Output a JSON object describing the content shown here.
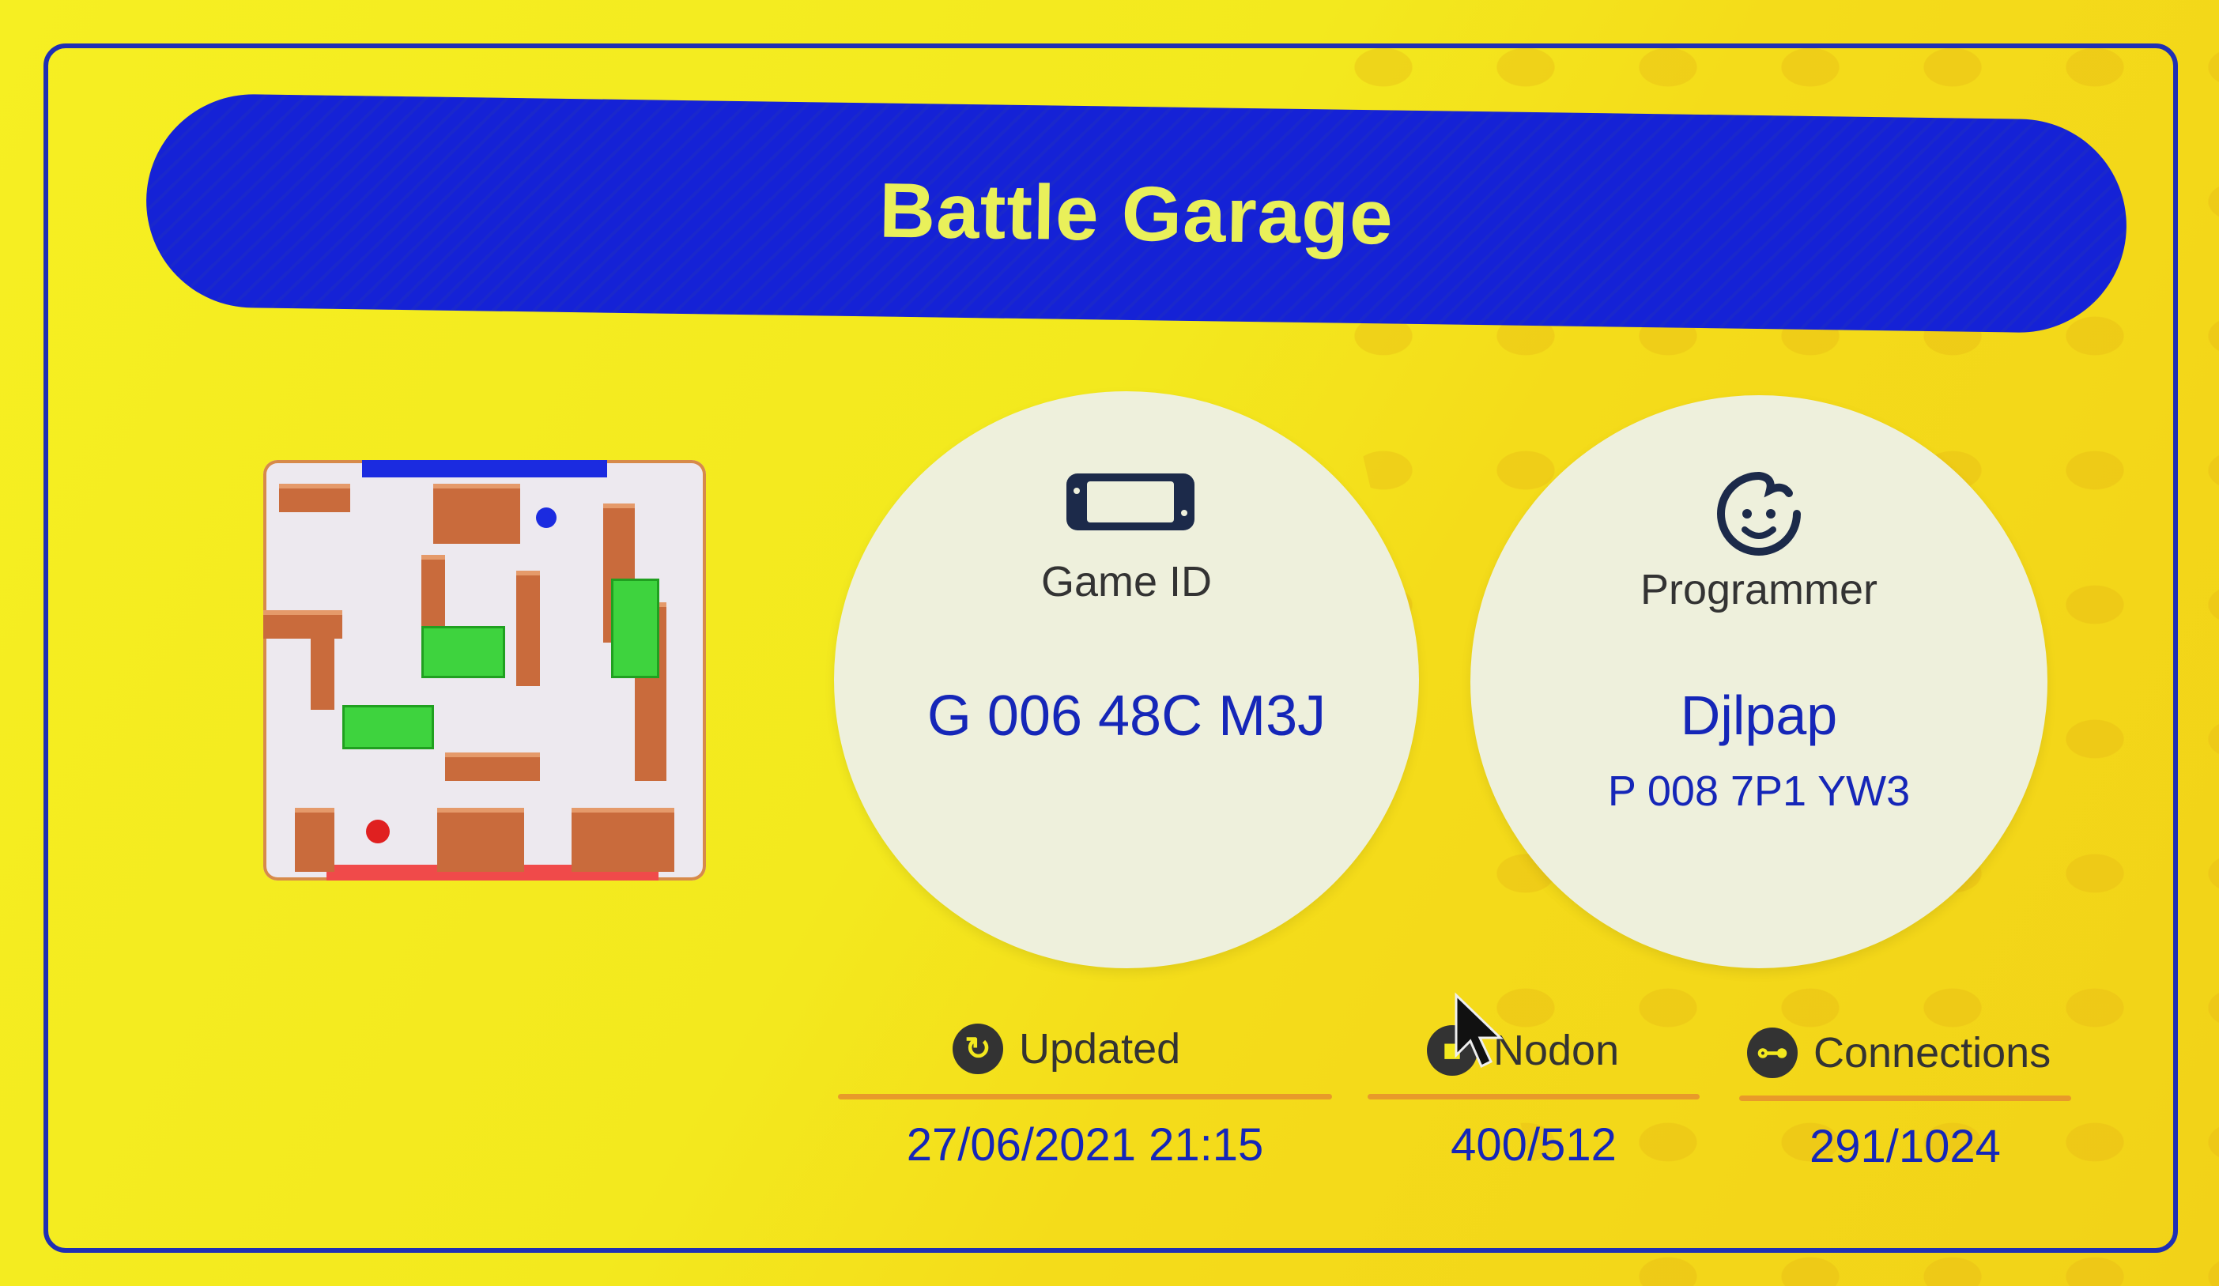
{
  "title": "Battle Garage",
  "game": {
    "label": "Game ID",
    "value": "G 006 48C M3J",
    "icon": "console-icon"
  },
  "programmer": {
    "label": "Programmer",
    "name": "Djlpap",
    "id": "P 008 7P1 YW3",
    "icon": "smiley-face-icon"
  },
  "stats": {
    "updated": {
      "label": "Updated",
      "value": "27/06/2021 21:15",
      "icon": "refresh-icon"
    },
    "nodon": {
      "label": "Nodon",
      "value": "400/512",
      "icon": "nodon-icon"
    },
    "connections": {
      "label": "Connections",
      "value": "291/1024",
      "icon": "connection-icon"
    }
  },
  "colors": {
    "background": "#f3e91e",
    "banner": "#1522d6",
    "title_text": "#e9f05a",
    "value_text": "#1526b8",
    "divider": "#e89a2a"
  }
}
